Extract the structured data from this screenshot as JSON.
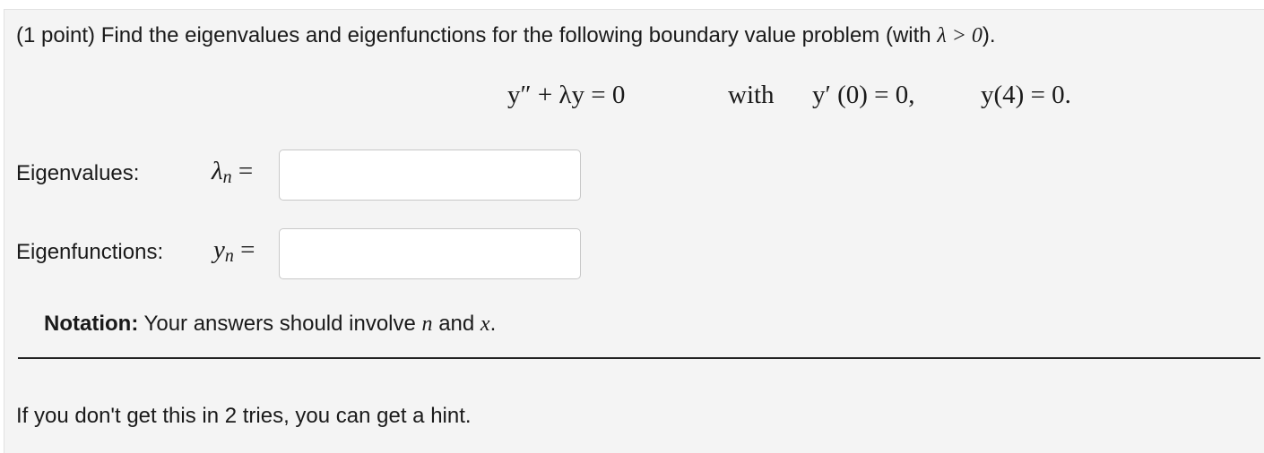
{
  "problem": {
    "points": "(1 point)",
    "text": "Find the eigenvalues and eigenfunctions for the following boundary value problem (with",
    "condition": "λ > 0",
    "close": ")."
  },
  "equation": {
    "ode": "y″ + λy = 0",
    "with": "with",
    "bc1": "y′ (0) = 0,",
    "bc2": "y(4) = 0."
  },
  "eigenvalues": {
    "label": "Eigenvalues:",
    "symbol": "λ",
    "subscript": "n",
    "equals": "=",
    "value": "",
    "placeholder": ""
  },
  "eigenfunctions": {
    "label": "Eigenfunctions:",
    "symbol": "y",
    "subscript": "n",
    "equals": "=",
    "value": "",
    "placeholder": ""
  },
  "notation": {
    "heading": "Notation:",
    "text": "Your answers should involve",
    "var1": "n",
    "conj": "and",
    "var2": "x",
    "end": "."
  },
  "hint": {
    "text": "If you don't get this in 2 tries, you can get a hint."
  }
}
